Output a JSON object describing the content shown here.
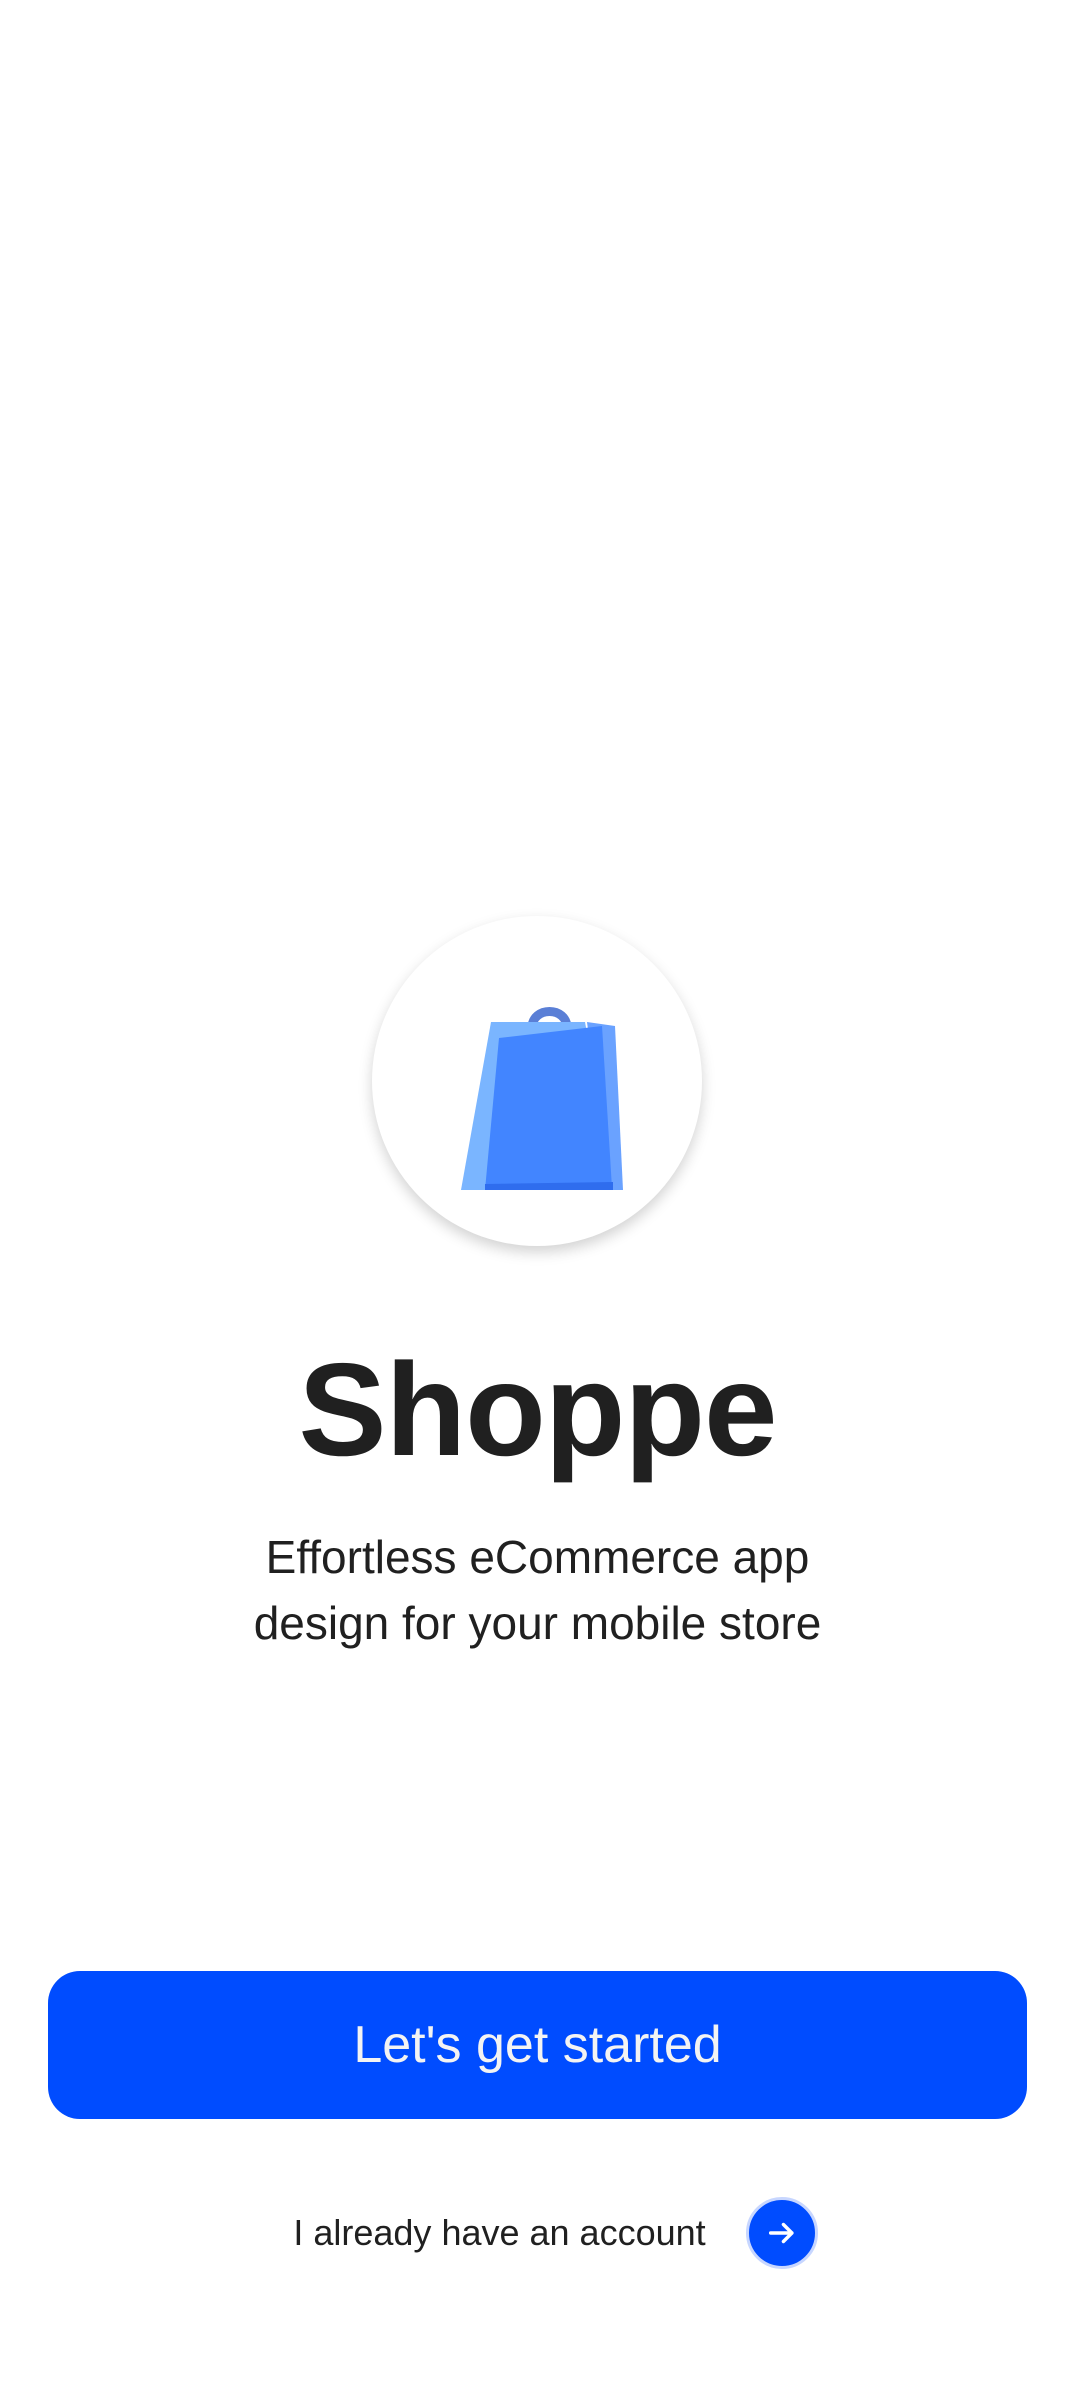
{
  "app": {
    "title": "Shoppe",
    "tagline": "Effortless eCommerce app design for your mobile store",
    "logo_icon": "shopping-bag-icon"
  },
  "actions": {
    "primary_label": "Let's get started",
    "secondary_label": "I already have an account",
    "secondary_icon": "arrow-right-icon"
  },
  "colors": {
    "brand": "#004cff",
    "bag_front": "#4285ff",
    "bag_back": "#7ab5ff",
    "bag_handle": "#5a7fd6",
    "text": "#202020",
    "background": "#ffffff"
  }
}
